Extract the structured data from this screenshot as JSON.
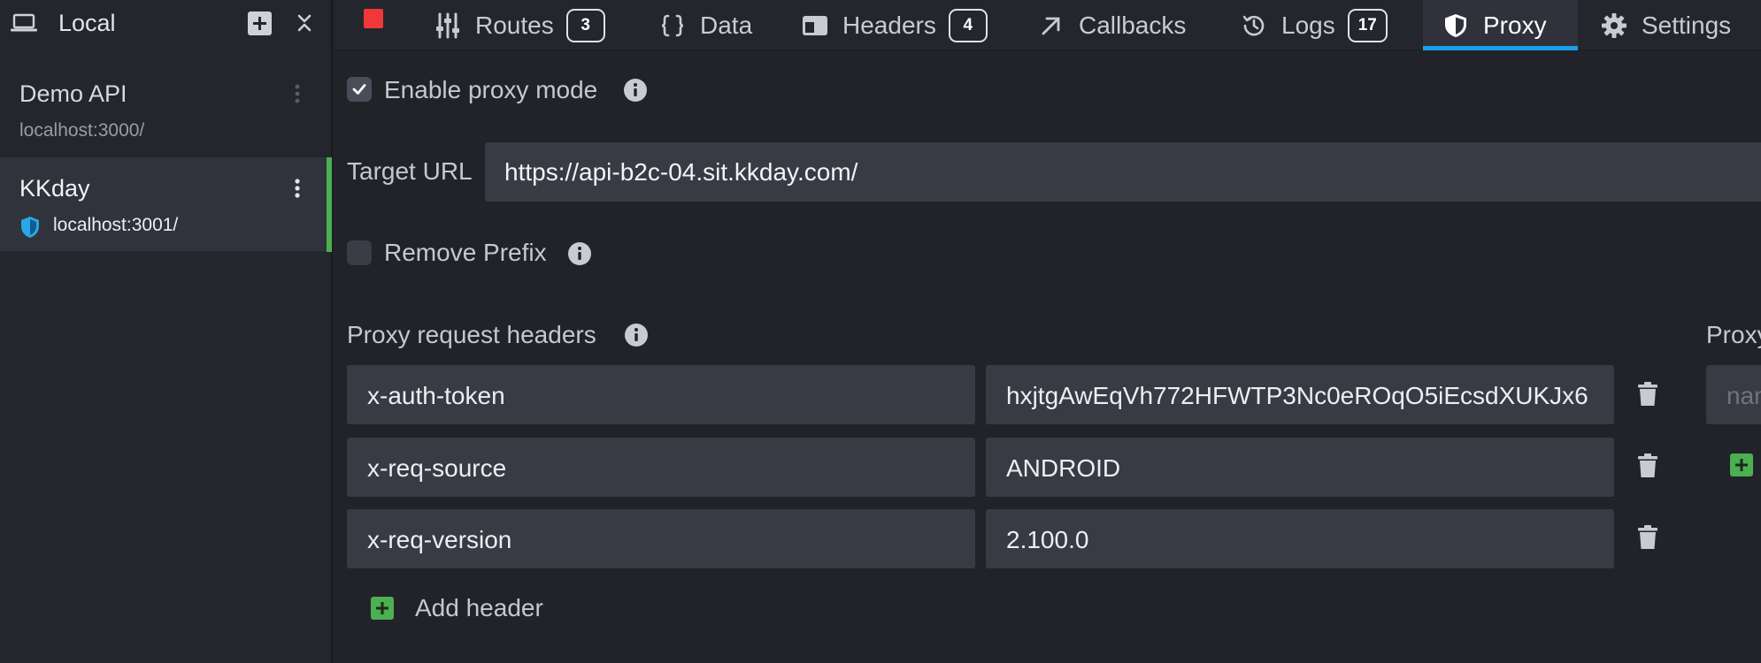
{
  "sidebar": {
    "environment_label": "Local",
    "environments": [
      {
        "name": "Demo API",
        "host": "localhost:3000/"
      },
      {
        "name": "KKday",
        "host": "localhost:3001/"
      }
    ]
  },
  "tabs": [
    {
      "label": "Routes",
      "badge": "3"
    },
    {
      "label": "Data"
    },
    {
      "label": "Headers",
      "badge": "4"
    },
    {
      "label": "Callbacks"
    },
    {
      "label": "Logs",
      "badge": "17"
    },
    {
      "label": "Proxy"
    },
    {
      "label": "Settings"
    }
  ],
  "proxy": {
    "enable_label": "Enable proxy mode",
    "enabled": true,
    "target_url_label": "Target URL",
    "target_url": "https://api-b2c-04.sit.kkday.com/",
    "remove_prefix_label": "Remove Prefix",
    "remove_prefix": false,
    "request_headers_label": "Proxy request headers",
    "request_headers": [
      {
        "key": "x-auth-token",
        "value": "hxjtgAwEqVh772HFWTP3Nc0eROqO5iEcsdXUKJx6"
      },
      {
        "key": "x-req-source",
        "value": "ANDROID"
      },
      {
        "key": "x-req-version",
        "value": "2.100.0"
      }
    ],
    "add_header_label": "Add header",
    "response_headers_label": "Proxy",
    "response_key_placeholder": "name"
  },
  "colors": {
    "accent_blue": "#1a9fe8",
    "accent_green": "#4caf50",
    "stop_red": "#f0373a"
  }
}
